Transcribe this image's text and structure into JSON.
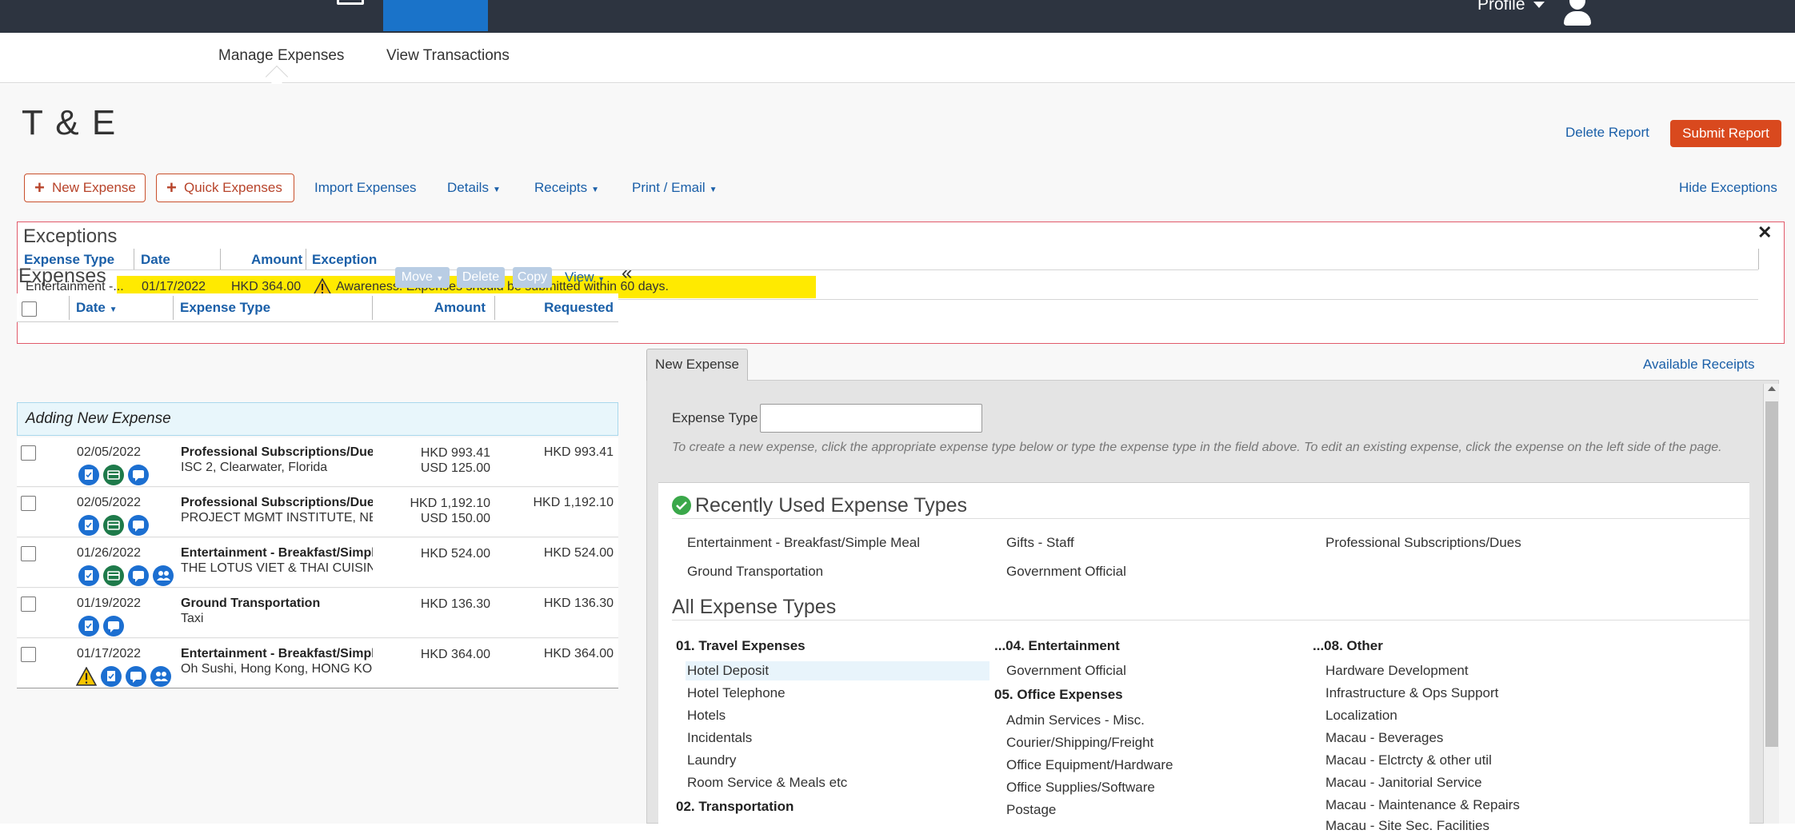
{
  "topbar": {
    "profile_label": "Profile"
  },
  "subnav": {
    "tabs": [
      {
        "label": "Manage Expenses"
      },
      {
        "label": "View Transactions"
      }
    ]
  },
  "report": {
    "title": "T & E",
    "delete_label": "Delete Report",
    "submit_label": "Submit Report"
  },
  "toolbar": {
    "new_expense": "New Expense",
    "quick_expenses": "Quick Expenses",
    "import_expenses": "Import Expenses",
    "details": "Details",
    "receipts": "Receipts",
    "print_email": "Print / Email",
    "hide_exceptions": "Hide Exceptions"
  },
  "exceptions": {
    "title": "Exceptions",
    "columns": {
      "expense_type": "Expense Type",
      "date": "Date",
      "amount": "Amount",
      "exception": "Exception"
    },
    "rows": [
      {
        "expense_type": "Entertainment -...",
        "date": "01/17/2022",
        "amount": "HKD 364.00",
        "exception": "Awareness: Expenses should be submitted within 60 days."
      }
    ]
  },
  "expenses": {
    "title": "Expenses",
    "buttons": {
      "move": "Move",
      "delete": "Delete",
      "copy": "Copy",
      "view": "View"
    },
    "columns": {
      "date": "Date",
      "expense_type": "Expense Type",
      "amount": "Amount",
      "requested": "Requested"
    },
    "adding_label": "Adding New Expense",
    "rows": [
      {
        "date": "02/05/2022",
        "type": "Professional Subscriptions/Dues",
        "vendor": "ISC 2, Clearwater, Florida",
        "amount": "HKD 993.41",
        "amount2": "USD 125.00",
        "requested": "HKD 993.41",
        "icons": [
          "receipt-icon",
          "card-icon",
          "comment-icon"
        ]
      },
      {
        "date": "02/05/2022",
        "type": "Professional Subscriptions/Dues",
        "vendor": "PROJECT MGMT INSTITUTE, NEWTOWN SQUARE",
        "amount": "HKD 1,192.10",
        "amount2": "USD 150.00",
        "requested": "HKD 1,192.10",
        "icons": [
          "receipt-icon",
          "card-icon",
          "comment-icon"
        ]
      },
      {
        "date": "01/26/2022",
        "type": "Entertainment - Breakfast/Simple Meal",
        "vendor": "THE LOTUS VIET & THAI CUISINE",
        "amount": "HKD 524.00",
        "amount2": "",
        "requested": "HKD 524.00",
        "icons": [
          "receipt-icon",
          "card-icon",
          "comment-icon",
          "attendees-icon"
        ]
      },
      {
        "date": "01/19/2022",
        "type": "Ground Transportation",
        "vendor": "Taxi",
        "amount": "HKD 136.30",
        "amount2": "",
        "requested": "HKD 136.30",
        "icons": [
          "receipt-icon",
          "comment-icon"
        ]
      },
      {
        "date": "01/17/2022",
        "type": "Entertainment - Breakfast/Simple Meal",
        "vendor": "Oh Sushi, Hong Kong, HONG KONG",
        "amount": "HKD 364.00",
        "amount2": "",
        "requested": "HKD 364.00",
        "icons": [
          "warning-icon",
          "receipt-icon",
          "comment-icon",
          "attendees-icon"
        ]
      }
    ]
  },
  "right_panel": {
    "tab_label": "New Expense",
    "available_receipts": "Available Receipts",
    "expense_type_label": "Expense Type",
    "expense_type_value": "",
    "hint": "To create a new expense, click the appropriate expense type below or type the expense type in the field above. To edit an existing expense, click the expense on the left side of the page.",
    "recently_used_title": "Recently Used Expense Types",
    "recently_used": [
      "Entertainment - Breakfast/Simple Meal",
      "Gifts - Staff",
      "Professional Subscriptions/Dues",
      "Ground Transportation",
      "Government Official"
    ],
    "all_title": "All Expense Types",
    "col1": {
      "cat1": "01. Travel Expenses",
      "items": [
        "Hotel Deposit",
        "Hotel Telephone",
        "Hotels",
        "Incidentals",
        "Laundry",
        "Room Service & Meals etc"
      ],
      "cat2": "02. Transportation"
    },
    "col2": {
      "cat1": "...04. Entertainment",
      "items1": [
        "Government Official"
      ],
      "cat2": "05. Office Expenses",
      "items2": [
        "Admin Services - Misc.",
        "Courier/Shipping/Freight",
        "Office Equipment/Hardware",
        "Office Supplies/Software",
        "Postage"
      ]
    },
    "col3": {
      "cat1": "...08. Other",
      "items": [
        "Hardware Development",
        "Infrastructure & Ops Support",
        "Localization",
        "Macau - Beverages",
        "Macau - Elctrcty & other util",
        "Macau - Janitorial Service",
        "Macau - Maintenance & Repairs",
        "Macau - Site Sec. Facilities"
      ]
    }
  },
  "colors": {
    "accent_orange": "#d9491e",
    "link_blue": "#1a5fa8",
    "highlight_yellow": "#ffea00",
    "topbar": "#2d3440"
  }
}
